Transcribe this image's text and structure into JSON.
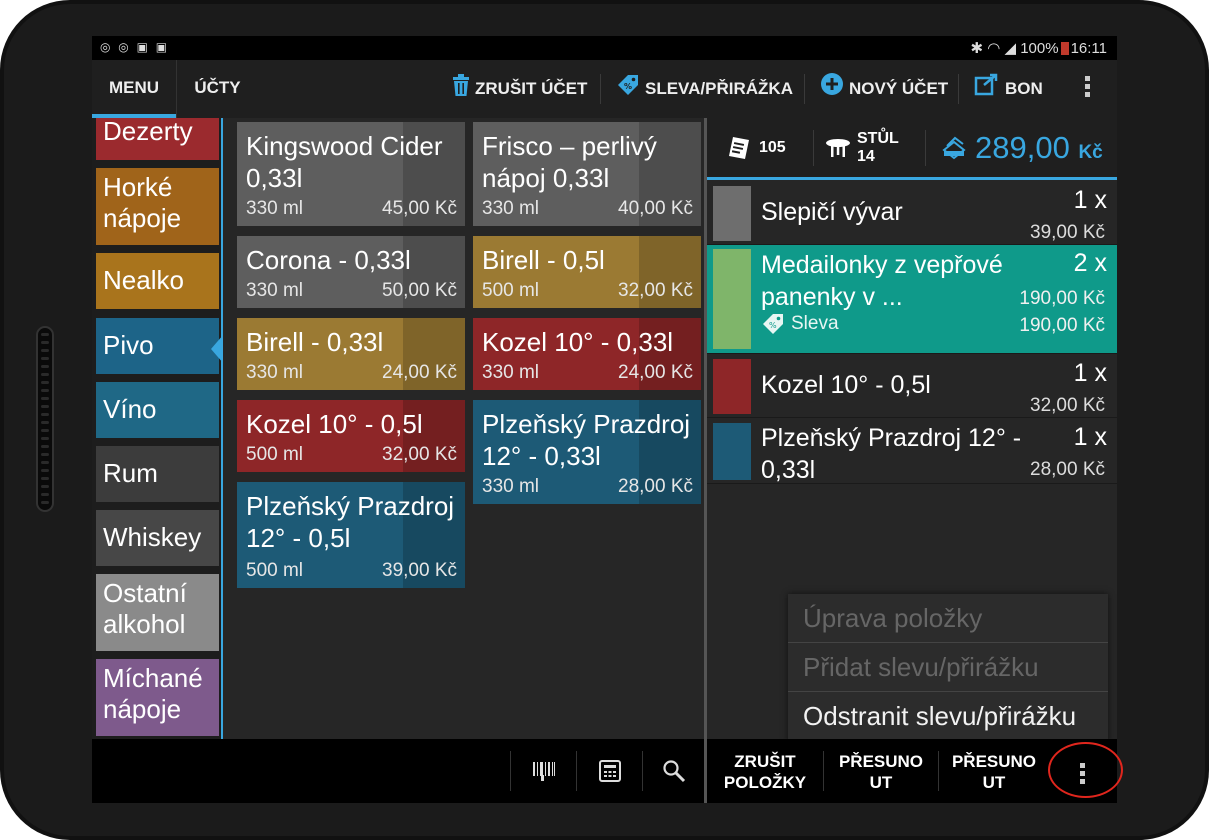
{
  "statusbar": {
    "left_icons": "◎ ◎ ▣ ▣",
    "signal_icons": "✱ ◠ ◢",
    "battery": "100%",
    "time": "16:11"
  },
  "tabs": [
    {
      "label": "MENU",
      "selected": true
    },
    {
      "label": "ÚČTY",
      "selected": false
    }
  ],
  "actions": {
    "cancel_account": "ZRUŠIT ÚČET",
    "discount": "SLEVA/PŘIRÁŽKA",
    "new_account": "NOVÝ ÚČET",
    "bon": "BON"
  },
  "categories": [
    {
      "label": "Dezerty",
      "color": "#9b2a2e"
    },
    {
      "label": "Horké nápoje",
      "color": "#a0641a"
    },
    {
      "label": "Nealko",
      "color": "#a9741c"
    },
    {
      "label": "Pivo",
      "color": "#1d6488",
      "selected": true
    },
    {
      "label": "Víno",
      "color": "#1f6886"
    },
    {
      "label": "Rum",
      "color": "#3c3c3c"
    },
    {
      "label": "Whiskey",
      "color": "#474747"
    },
    {
      "label": "Ostatní alkohol",
      "color": "#8a8a8a"
    },
    {
      "label": "Míchané nápoje",
      "color": "#7e5a8c"
    }
  ],
  "products": [
    {
      "name": "Kingswood Cider 0,33l",
      "volume": "330 ml",
      "price": "45,00 Kč",
      "color": "#5e5e5e"
    },
    {
      "name": "Frisco – perlivý nápoj 0,33l",
      "volume": "330 ml",
      "price": "40,00 Kč",
      "color": "#5e5e5e"
    },
    {
      "name": "Corona - 0,33l",
      "volume": "330 ml",
      "price": "50,00 Kč",
      "color": "#5e5e5e"
    },
    {
      "name": "Birell - 0,5l",
      "volume": "500 ml",
      "price": "32,00 Kč",
      "color": "#9b7a33"
    },
    {
      "name": "Birell - 0,33l",
      "volume": "330 ml",
      "price": "24,00 Kč",
      "color": "#9b7a33"
    },
    {
      "name": "Kozel 10° - 0,33l",
      "volume": "330 ml",
      "price": "24,00 Kč",
      "color": "#8e2628"
    },
    {
      "name": "Kozel 10° - 0,5l",
      "volume": "500 ml",
      "price": "32,00 Kč",
      "color": "#8e2628"
    },
    {
      "name": "Plzeňský Prazdroj 12° - 0,33l",
      "volume": "330 ml",
      "price": "28,00 Kč",
      "color": "#1d5a76"
    },
    {
      "name": "Plzeňský Prazdroj 12° - 0,5l",
      "volume": "500 ml",
      "price": "39,00 Kč",
      "color": "#1d5a76"
    }
  ],
  "order": {
    "receipts": "105",
    "table_label": "STŮL",
    "table_number": "14",
    "total": "289,00",
    "currency": "Kč",
    "items": [
      {
        "name": "Slepičí vývar",
        "qty": "1 x",
        "price": "39,00 Kč",
        "color": "#6e6e6e"
      },
      {
        "name": "Medailonky z vepřové panenky v ...",
        "qty": "2 x",
        "price": "190,00 Kč",
        "discount_label": "Sleva",
        "discount_price": "190,00 Kč",
        "color": "#7fb56a",
        "selected": true
      },
      {
        "name": "Kozel 10° - 0,5l",
        "qty": "1 x",
        "price": "32,00 Kč",
        "color": "#8e2628"
      },
      {
        "name": "Plzeňský Prazdroj 12° - 0,33l",
        "qty": "1 x",
        "price": "28,00 Kč",
        "color": "#1d5a76"
      }
    ]
  },
  "popup_menu": [
    {
      "label": "Úprava položky",
      "enabled": false
    },
    {
      "label": "Přidat slevu/přirážku",
      "enabled": false
    },
    {
      "label": "Odstranit slevu/přirážku",
      "enabled": true
    }
  ],
  "bottom_right": {
    "cancel_items_1": "ZRUŠIT",
    "cancel_items_2": "POLOŽKY",
    "move1_1": "PŘESUNO",
    "move1_2": "UT",
    "move2_1": "PŘESUNO",
    "move2_2": "UT"
  },
  "colors": {
    "accent": "#39a7e0",
    "selected_row": "#0f9a8a",
    "highlight_circle": "#e0261d"
  }
}
